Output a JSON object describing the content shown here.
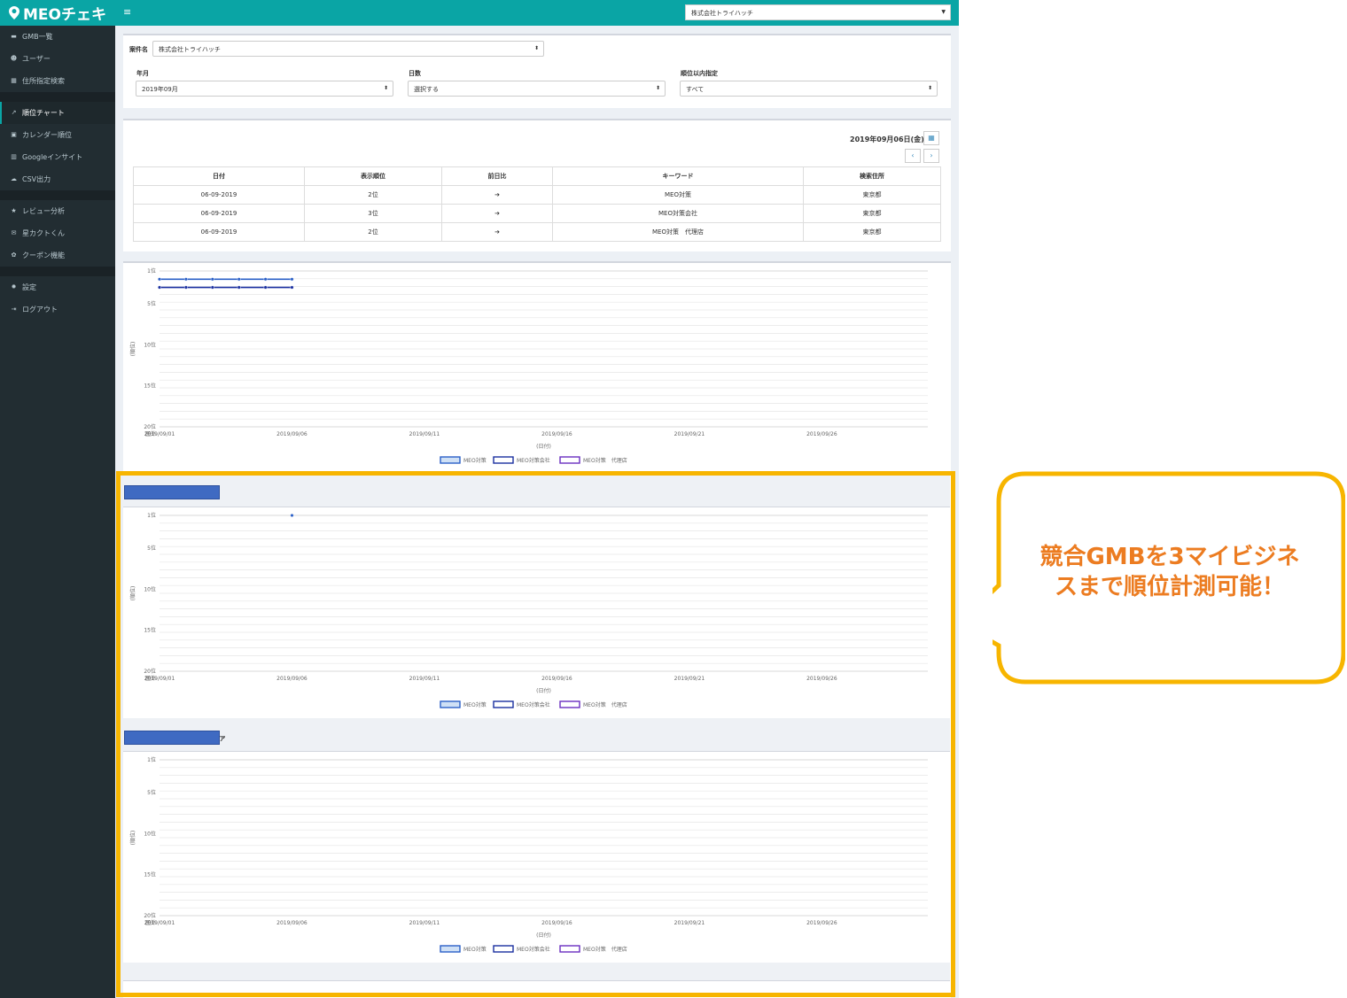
{
  "app": {
    "title": "MEOチェキ",
    "menu_icon": "hamburger-icon"
  },
  "topbar": {
    "company_select": "株式会社トライハッチ"
  },
  "sidebar": {
    "items": [
      {
        "label": "GMB一覧",
        "icon": "store-icon"
      },
      {
        "label": "ユーザー",
        "icon": "users-icon"
      },
      {
        "label": "住所指定検索",
        "icon": "map-icon"
      },
      {
        "label": "順位チャート",
        "icon": "line-chart-icon"
      },
      {
        "label": "カレンダー順位",
        "icon": "calendar-icon"
      },
      {
        "label": "Googleインサイト",
        "icon": "bar-chart-icon"
      },
      {
        "label": "CSV出力",
        "icon": "cloud-download-icon"
      },
      {
        "label": "レビュー分析",
        "icon": "star-icon"
      },
      {
        "label": "星カクトくん",
        "icon": "envelope-icon"
      },
      {
        "label": "クーポン機能",
        "icon": "gift-icon"
      },
      {
        "label": "設定",
        "icon": "gear-icon"
      },
      {
        "label": "ログアウト",
        "icon": "sign-out-icon"
      }
    ]
  },
  "filters": {
    "project_label": "案件名",
    "project_value": "株式会社トライハッチ",
    "month_label": "年月",
    "month_value": "2019年09月",
    "days_label": "日数",
    "days_value": "選択する",
    "rank_label": "順位以内指定",
    "rank_value": "すべて"
  },
  "ranking": {
    "date": "2019年09月06日(金)",
    "columns": [
      "日付",
      "表示順位",
      "前日比",
      "キーワード",
      "検索住所"
    ],
    "rows": [
      [
        "06-09-2019",
        "2位",
        "➔",
        "MEO対策",
        "東京都"
      ],
      [
        "06-09-2019",
        "3位",
        "➔",
        "MEO対策会社",
        "東京都"
      ],
      [
        "06-09-2019",
        "2位",
        "➔",
        "MEO対策　代理店",
        "東京都"
      ]
    ]
  },
  "chart_labels": {
    "ylabel": "(順位)",
    "xlabel": "(日付)"
  },
  "competitor2_suffix": "ァ",
  "callout": {
    "line1": "競合GMBを3マイビジネ",
    "line2": "スまで順位計測可能！"
  },
  "colors": {
    "accent": "#0aa5a5",
    "highlight": "#f7b500",
    "callout_text": "#ec7c21"
  },
  "chart_data": [
    {
      "type": "line",
      "y_reversed": true,
      "ylim": [
        1,
        20
      ],
      "yticks": [
        "1位",
        "5位",
        "10位",
        "15位",
        "20位\n圏外"
      ],
      "x": [
        "2019/09/01",
        "2019/09/02",
        "2019/09/03",
        "2019/09/04",
        "2019/09/05",
        "2019/09/06"
      ],
      "xticks": [
        "2019/09/01",
        "2019/09/06",
        "2019/09/11",
        "2019/09/16",
        "2019/09/21",
        "2019/09/26"
      ],
      "series": [
        {
          "name": "MEO対策",
          "color": "#2a5fc7",
          "values": [
            2,
            2,
            2,
            2,
            2,
            2
          ]
        },
        {
          "name": "MEO対策会社",
          "color": "#1a2fa0",
          "values": [
            3,
            3,
            3,
            3,
            3,
            3
          ]
        },
        {
          "name": "MEO対策　代理店",
          "color": "#6a2ec0",
          "values": []
        }
      ]
    },
    {
      "type": "line",
      "y_reversed": true,
      "ylim": [
        1,
        20
      ],
      "yticks": [
        "1位",
        "5位",
        "10位",
        "15位",
        "20位\n圏外"
      ],
      "x": [
        "2019/09/06"
      ],
      "xticks": [
        "2019/09/01",
        "2019/09/06",
        "2019/09/11",
        "2019/09/16",
        "2019/09/21",
        "2019/09/26"
      ],
      "series": [
        {
          "name": "MEO対策",
          "color": "#2a5fc7",
          "values": [
            1
          ]
        },
        {
          "name": "MEO対策会社",
          "color": "#1a2fa0",
          "values": []
        },
        {
          "name": "MEO対策　代理店",
          "color": "#6a2ec0",
          "values": []
        }
      ]
    },
    {
      "type": "line",
      "y_reversed": true,
      "ylim": [
        1,
        20
      ],
      "yticks": [
        "1位",
        "5位",
        "10位",
        "15位",
        "20位\n圏外"
      ],
      "x": [],
      "xticks": [
        "2019/09/01",
        "2019/09/06",
        "2019/09/11",
        "2019/09/16",
        "2019/09/21",
        "2019/09/26"
      ],
      "series": [
        {
          "name": "MEO対策",
          "color": "#2a5fc7",
          "values": []
        },
        {
          "name": "MEO対策会社",
          "color": "#1a2fa0",
          "values": []
        },
        {
          "name": "MEO対策　代理店",
          "color": "#6a2ec0",
          "values": []
        }
      ]
    }
  ]
}
